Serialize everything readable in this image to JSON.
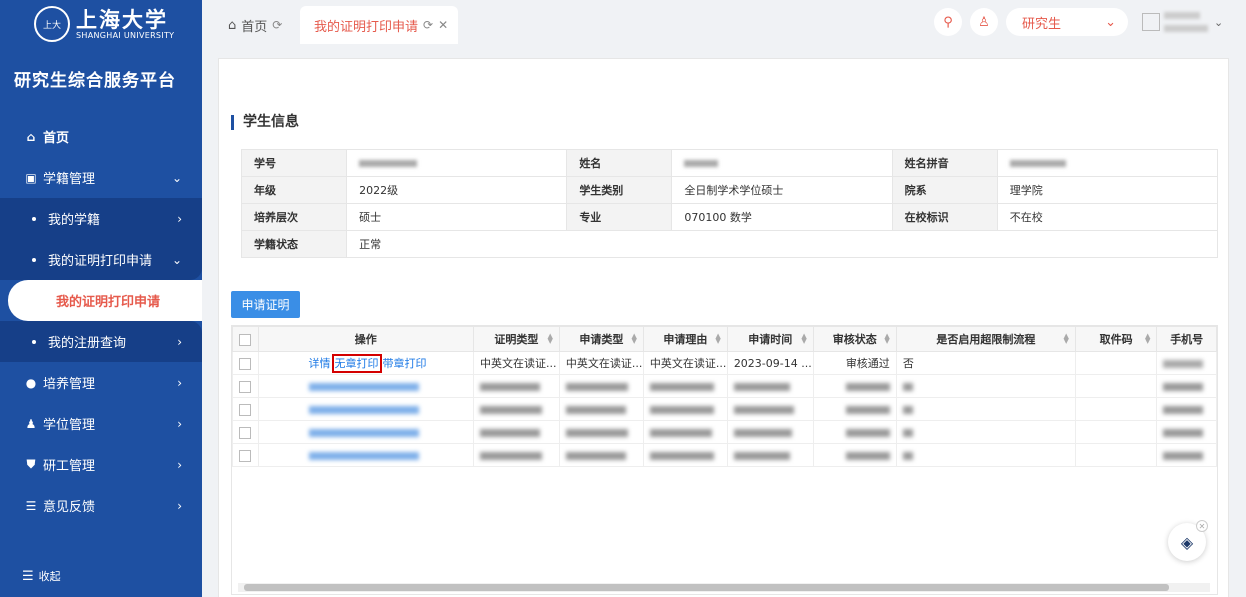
{
  "logo": {
    "cn": "上海大学",
    "en": "SHANGHAI UNIVERSITY",
    "emblem": "上大"
  },
  "platform_title": "研究生综合服务平台",
  "menu": {
    "home": "首页",
    "xueji": "学籍管理",
    "my_xueji": "我的学籍",
    "cert_apply": "我的证明打印申请",
    "cert_apply_active": "我的证明打印申请",
    "register_query": "我的注册查询",
    "peiyang": "培养管理",
    "xuewei": "学位管理",
    "yangong": "研工管理",
    "feedback": "意见反馈",
    "collapse": "收起"
  },
  "tabs": {
    "home": "首页",
    "cert": "我的证明打印申请"
  },
  "header": {
    "role": "研究生"
  },
  "student_info": {
    "title": "学生信息",
    "labels": {
      "xuehao": "学号",
      "name": "姓名",
      "pinyin": "姓名拼音",
      "grade": "年级",
      "category": "学生类别",
      "dept": "院系",
      "level": "培养层次",
      "major": "专业",
      "status_flag": "在校标识",
      "xueji_status": "学籍状态"
    },
    "values": {
      "grade": "2022级",
      "category": "全日制学术学位硕士",
      "dept": "理学院",
      "level": "硕士",
      "major": "070100 数学",
      "status_flag": "不在校",
      "xueji_status": "正常"
    }
  },
  "apply_button": "申请证明",
  "grid": {
    "columns": [
      "操作",
      "证明类型",
      "申请类型",
      "申请理由",
      "申请时间",
      "审核状态",
      "是否启用超限制流程",
      "取件码",
      "手机号"
    ],
    "first_row": {
      "actions": [
        "详情",
        "无章打印",
        "带章打印"
      ],
      "cert_type": "中英文在读证...",
      "apply_type": "中英文在读证...",
      "reason": "中英文在读证...",
      "time": "2023-09-14 ...",
      "status": "审核通过",
      "overlimit": "否"
    }
  }
}
